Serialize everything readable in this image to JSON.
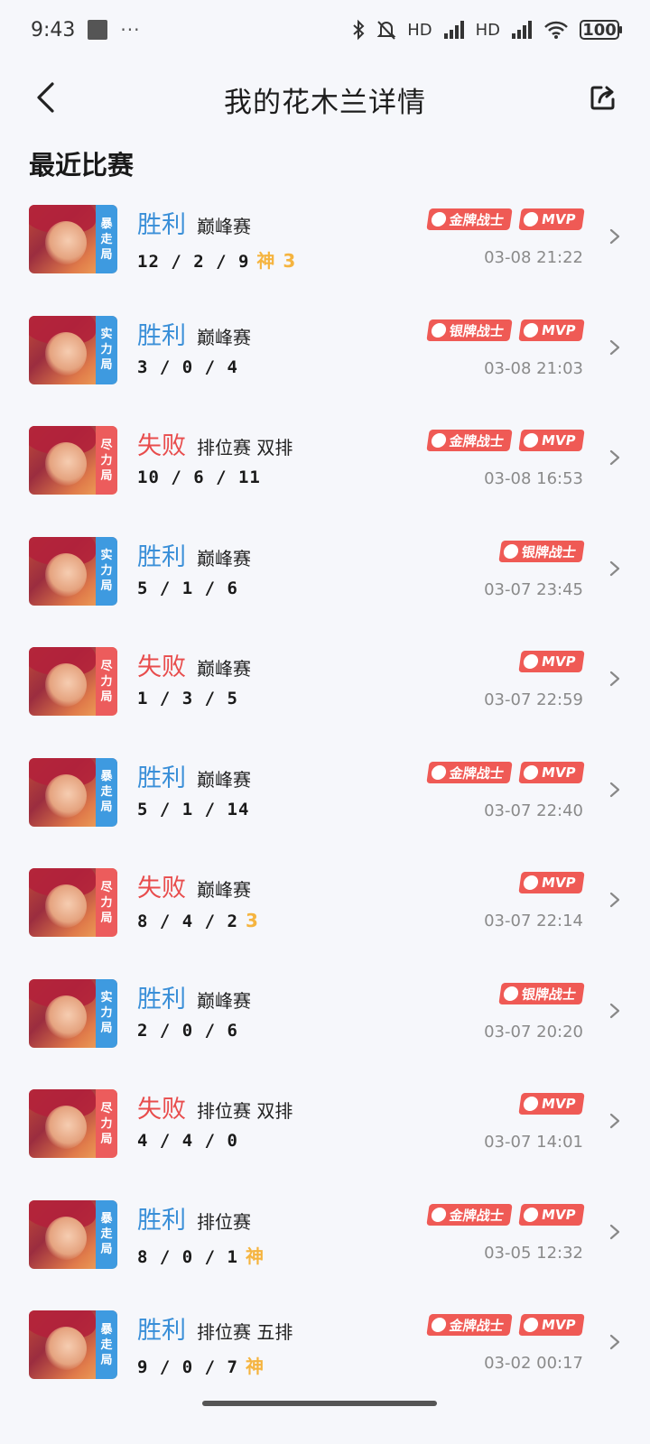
{
  "status": {
    "time": "9:43",
    "dots": "···",
    "battery": "100",
    "hd1": "HD",
    "hd2": "HD"
  },
  "header": {
    "title": "我的花木兰详情"
  },
  "section": {
    "title": "最近比赛"
  },
  "matches": [
    {
      "mode_tag": [
        "暴",
        "走",
        "局"
      ],
      "tag_color": "blue",
      "result": "胜利",
      "result_type": "win",
      "mode": "巅峰赛",
      "kda": "12 / 2 / 9",
      "extra": "神 3",
      "badges": [
        "金牌战士",
        "MVP"
      ],
      "date": "03-08 21:22"
    },
    {
      "mode_tag": [
        "实",
        "力",
        "局"
      ],
      "tag_color": "blue",
      "result": "胜利",
      "result_type": "win",
      "mode": "巅峰赛",
      "kda": "3 / 0 / 4",
      "extra": "",
      "badges": [
        "银牌战士",
        "MVP"
      ],
      "date": "03-08 21:03"
    },
    {
      "mode_tag": [
        "尽",
        "力",
        "局"
      ],
      "tag_color": "red",
      "result": "失败",
      "result_type": "lose",
      "mode": "排位赛 双排",
      "kda": "10 / 6 / 11",
      "extra": "",
      "badges": [
        "金牌战士",
        "MVP"
      ],
      "date": "03-08 16:53"
    },
    {
      "mode_tag": [
        "实",
        "力",
        "局"
      ],
      "tag_color": "blue",
      "result": "胜利",
      "result_type": "win",
      "mode": "巅峰赛",
      "kda": "5 / 1 / 6",
      "extra": "",
      "badges": [
        "银牌战士"
      ],
      "date": "03-07 23:45"
    },
    {
      "mode_tag": [
        "尽",
        "力",
        "局"
      ],
      "tag_color": "red",
      "result": "失败",
      "result_type": "lose",
      "mode": "巅峰赛",
      "kda": "1 / 3 / 5",
      "extra": "",
      "badges": [
        "MVP"
      ],
      "date": "03-07 22:59"
    },
    {
      "mode_tag": [
        "暴",
        "走",
        "局"
      ],
      "tag_color": "blue",
      "result": "胜利",
      "result_type": "win",
      "mode": "巅峰赛",
      "kda": "5 / 1 / 14",
      "extra": "",
      "badges": [
        "金牌战士",
        "MVP"
      ],
      "date": "03-07 22:40"
    },
    {
      "mode_tag": [
        "尽",
        "力",
        "局"
      ],
      "tag_color": "red",
      "result": "失败",
      "result_type": "lose",
      "mode": "巅峰赛",
      "kda": "8 / 4 / 2",
      "extra": "3",
      "badges": [
        "MVP"
      ],
      "date": "03-07 22:14"
    },
    {
      "mode_tag": [
        "实",
        "力",
        "局"
      ],
      "tag_color": "blue",
      "result": "胜利",
      "result_type": "win",
      "mode": "巅峰赛",
      "kda": "2 / 0 / 6",
      "extra": "",
      "badges": [
        "银牌战士"
      ],
      "date": "03-07 20:20"
    },
    {
      "mode_tag": [
        "尽",
        "力",
        "局"
      ],
      "tag_color": "red",
      "result": "失败",
      "result_type": "lose",
      "mode": "排位赛 双排",
      "kda": "4 / 4 / 0",
      "extra": "",
      "badges": [
        "MVP"
      ],
      "date": "03-07 14:01"
    },
    {
      "mode_tag": [
        "暴",
        "走",
        "局"
      ],
      "tag_color": "blue",
      "result": "胜利",
      "result_type": "win",
      "mode": "排位赛",
      "kda": "8 / 0 / 1",
      "extra": "神",
      "badges": [
        "金牌战士",
        "MVP"
      ],
      "date": "03-05 12:32"
    },
    {
      "mode_tag": [
        "暴",
        "走",
        "局"
      ],
      "tag_color": "blue",
      "result": "胜利",
      "result_type": "win",
      "mode": "排位赛 五排",
      "kda": "9 / 0 / 7",
      "extra": "神",
      "badges": [
        "金牌战士",
        "MVP"
      ],
      "date": "03-02 00:17"
    }
  ],
  "colors": {
    "win": "#3a8fd8",
    "lose": "#e84c4c",
    "badge": "#ef5a55",
    "extra": "#f5b43f"
  }
}
